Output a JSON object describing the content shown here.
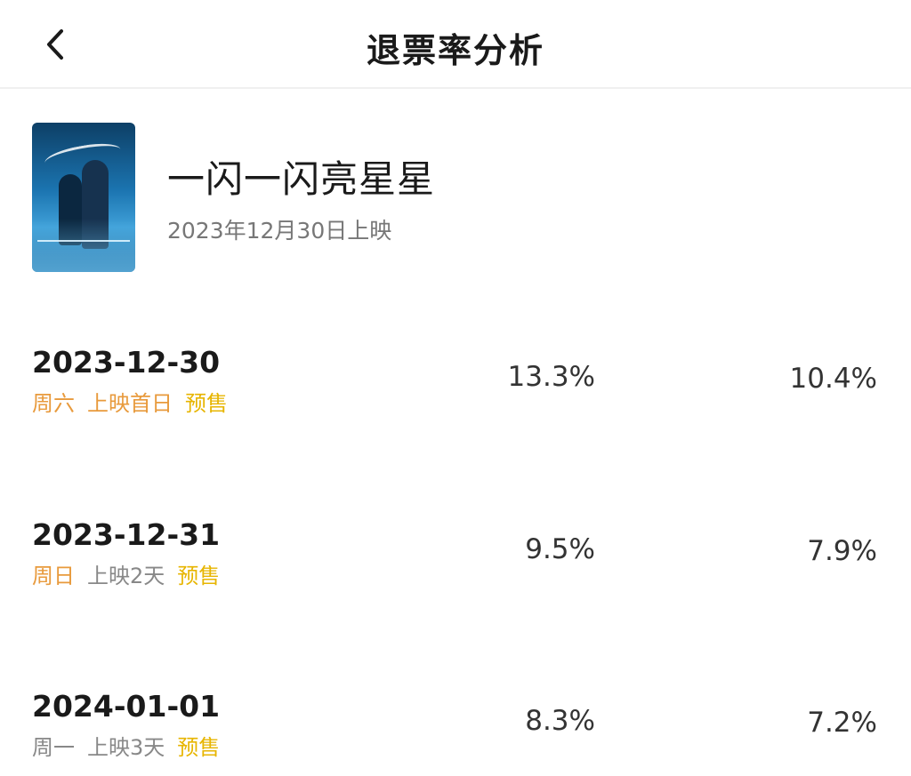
{
  "header": {
    "title": "退票率分析",
    "back_icon": "chevron-left-icon"
  },
  "movie": {
    "title": "一闪一闪亮星星",
    "release": "2023年12月30日上映",
    "poster_colors": [
      "#0d3f66",
      "#3fa0d8"
    ]
  },
  "rows": [
    {
      "date": "2023-12-30",
      "weekday": "周六",
      "status": "上映首日",
      "presale": "预售",
      "value1": "13.3%",
      "value2": "10.4%"
    },
    {
      "date": "2023-12-31",
      "weekday": "周日",
      "status": "上映2天",
      "presale": "预售",
      "value1": "9.5%",
      "value2": "7.9%"
    },
    {
      "date": "2024-01-01",
      "weekday": "周一",
      "status": "上映3天",
      "presale": "预售",
      "value1": "8.3%",
      "value2": "7.2%"
    }
  ],
  "colors": {
    "weekend": "#e89a3c",
    "first_day": "#e89a3c",
    "muted": "#888888",
    "presale": "#e7b500"
  }
}
